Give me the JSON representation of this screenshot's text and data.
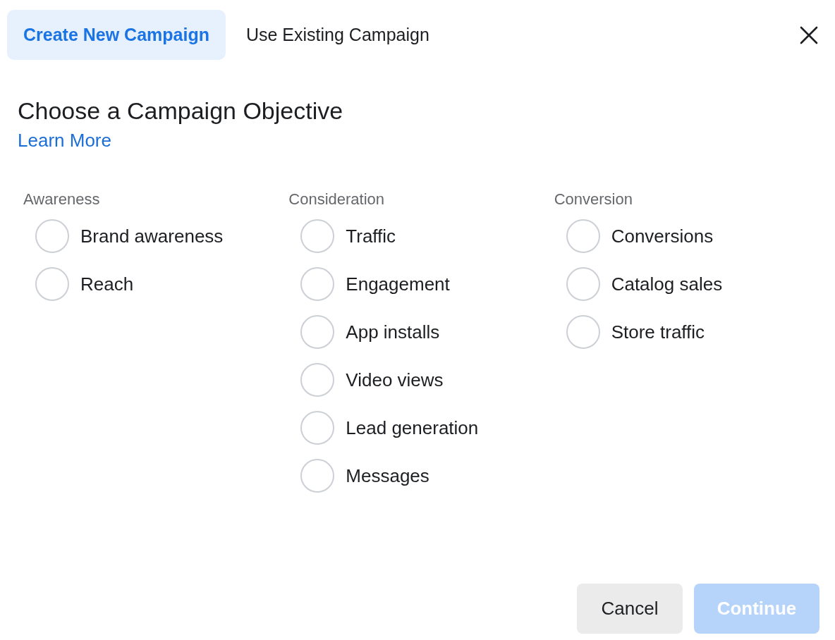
{
  "tabs": [
    {
      "label": "Create New Campaign",
      "selected": true
    },
    {
      "label": "Use Existing Campaign",
      "selected": false
    }
  ],
  "heading": "Choose a Campaign Objective",
  "learn_more": "Learn More",
  "groups": [
    {
      "label": "Awareness",
      "options": [
        {
          "label": "Brand awareness",
          "selected": false
        },
        {
          "label": "Reach",
          "selected": false
        }
      ]
    },
    {
      "label": "Consideration",
      "options": [
        {
          "label": "Traffic",
          "selected": false
        },
        {
          "label": "Engagement",
          "selected": false
        },
        {
          "label": "App installs",
          "selected": false
        },
        {
          "label": "Video views",
          "selected": false
        },
        {
          "label": "Lead generation",
          "selected": false
        },
        {
          "label": "Messages",
          "selected": false
        }
      ]
    },
    {
      "label": "Conversion",
      "options": [
        {
          "label": "Conversions",
          "selected": false
        },
        {
          "label": "Catalog sales",
          "selected": false
        },
        {
          "label": "Store traffic",
          "selected": false
        }
      ]
    }
  ],
  "buttons": [
    {
      "label": "Cancel",
      "kind": "secondary",
      "disabled": false
    },
    {
      "label": "Continue",
      "kind": "primary",
      "disabled": true
    }
  ]
}
